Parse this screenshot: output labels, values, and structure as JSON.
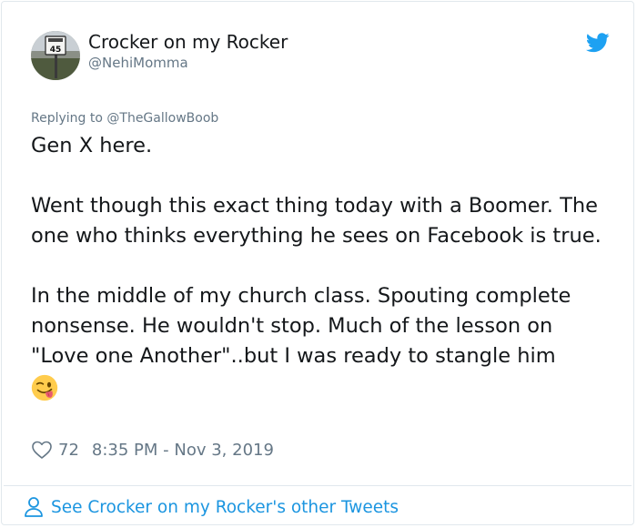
{
  "tweet": {
    "author_name": "Crocker on my Rocker",
    "author_handle": "@NehiMomma",
    "avatar_sign_text": "45",
    "replying_prefix": "Replying to ",
    "replying_to": "@TheGallowBoob",
    "paragraph_1": "Gen X here.",
    "paragraph_2": "Went though this exact thing today with a Boomer. The one who thinks everything he sees on Facebook is true.",
    "paragraph_3": "In the middle of my church class. Spouting complete nonsense. He wouldn't stop. Much of the lesson on \"Love one Another\"..but I was ready to stangle him",
    "emoji": "winking-face-with-tongue",
    "like_count": "72",
    "timestamp": "8:35 PM - Nov 3, 2019",
    "footer_link": "See Crocker on my Rocker's other Tweets"
  },
  "colors": {
    "text": "#14171a",
    "secondary_text": "#657786",
    "link_blue": "#1b95e0",
    "twitter_blue": "#1da1f2",
    "border": "#e1e8ed"
  }
}
